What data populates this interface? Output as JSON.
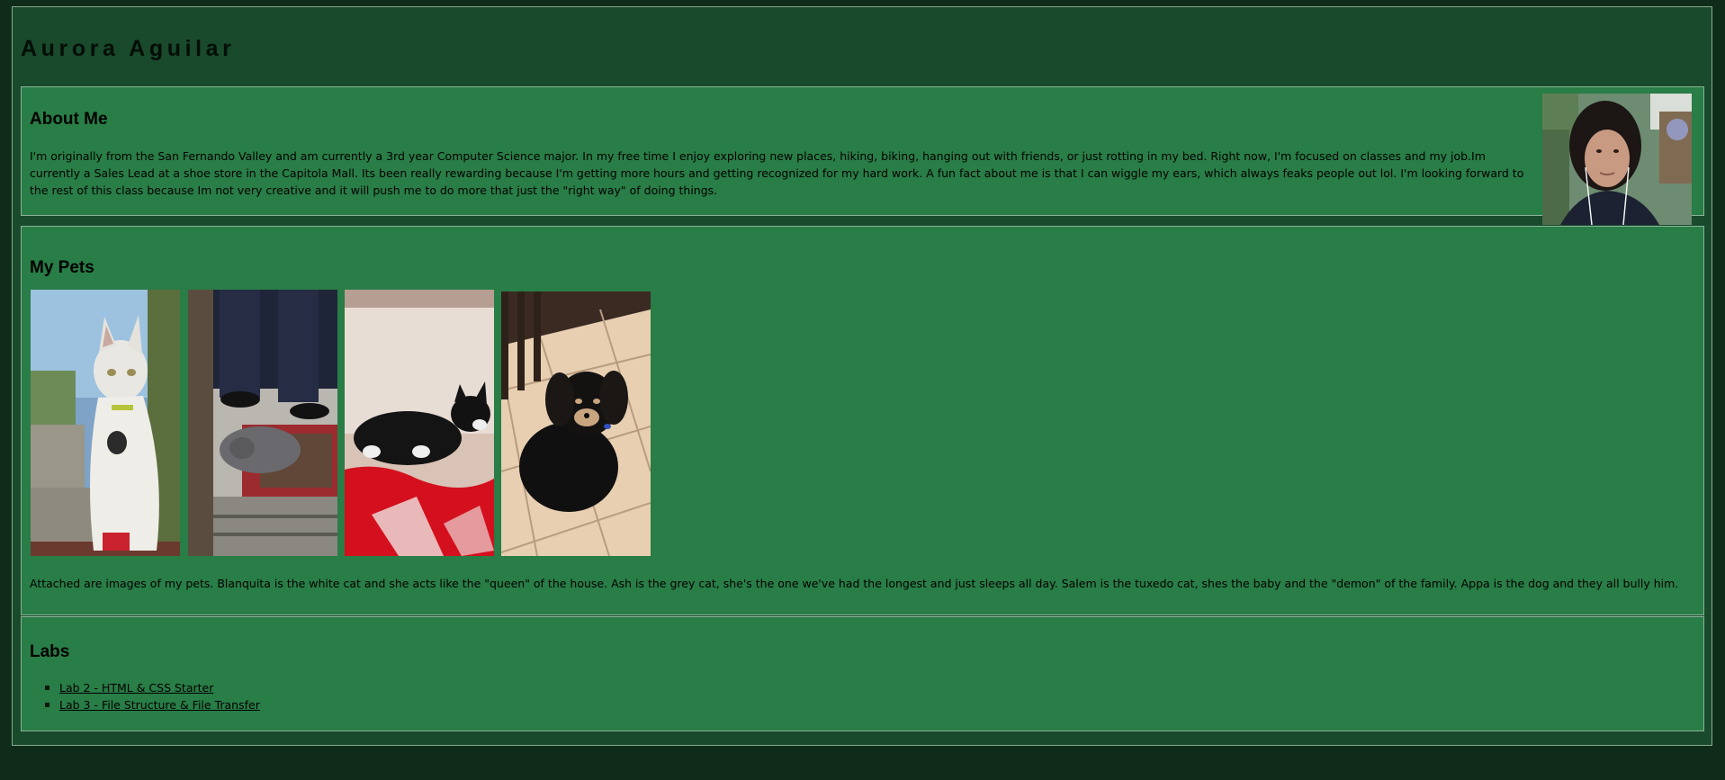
{
  "site": {
    "title": "Aurora Aguilar"
  },
  "about": {
    "heading": "About Me",
    "text": "I'm originally from the San Fernando Valley and am currently a 3rd year Computer Science major. In my free time I enjoy exploring new places, hiking, biking, hanging out with friends, or just rotting in my bed. Right now, I'm focused on classes and my job.Im currently a Sales Lead at a shoe store in the Capitola Mall. Its been really rewarding because I'm getting more hours and getting recognized for my hard work. A fun fact about me is that I can wiggle my ears, which always feaks people out lol. I'm looking forward to the rest of this class because Im not very creative and it will push me to do more that just the \"right way\" of doing things."
  },
  "pets": {
    "heading": "My Pets",
    "photos": [
      "white-cat-photo",
      "grey-cat-photo",
      "tuxedo-cat-photo",
      "black-dog-photo"
    ],
    "caption": "Attached are images of my pets. Blanquita is the white cat and she acts like the \"queen\" of the house. Ash is the grey cat, she's the one we've had the longest and just sleeps all day. Salem is the tuxedo cat, shes the baby and the \"demon\" of the family. Appa is the dog and they all bully him."
  },
  "labs": {
    "heading": "Labs",
    "links": [
      {
        "label": "Lab 2 - HTML & CSS Starter"
      },
      {
        "label": "Lab 3 - File Structure & File Transfer"
      }
    ]
  },
  "colors": {
    "page_background": "#0f2c1a",
    "container_background": "#184a2b",
    "section_background": "#297d46",
    "border": "#8cb39a"
  }
}
